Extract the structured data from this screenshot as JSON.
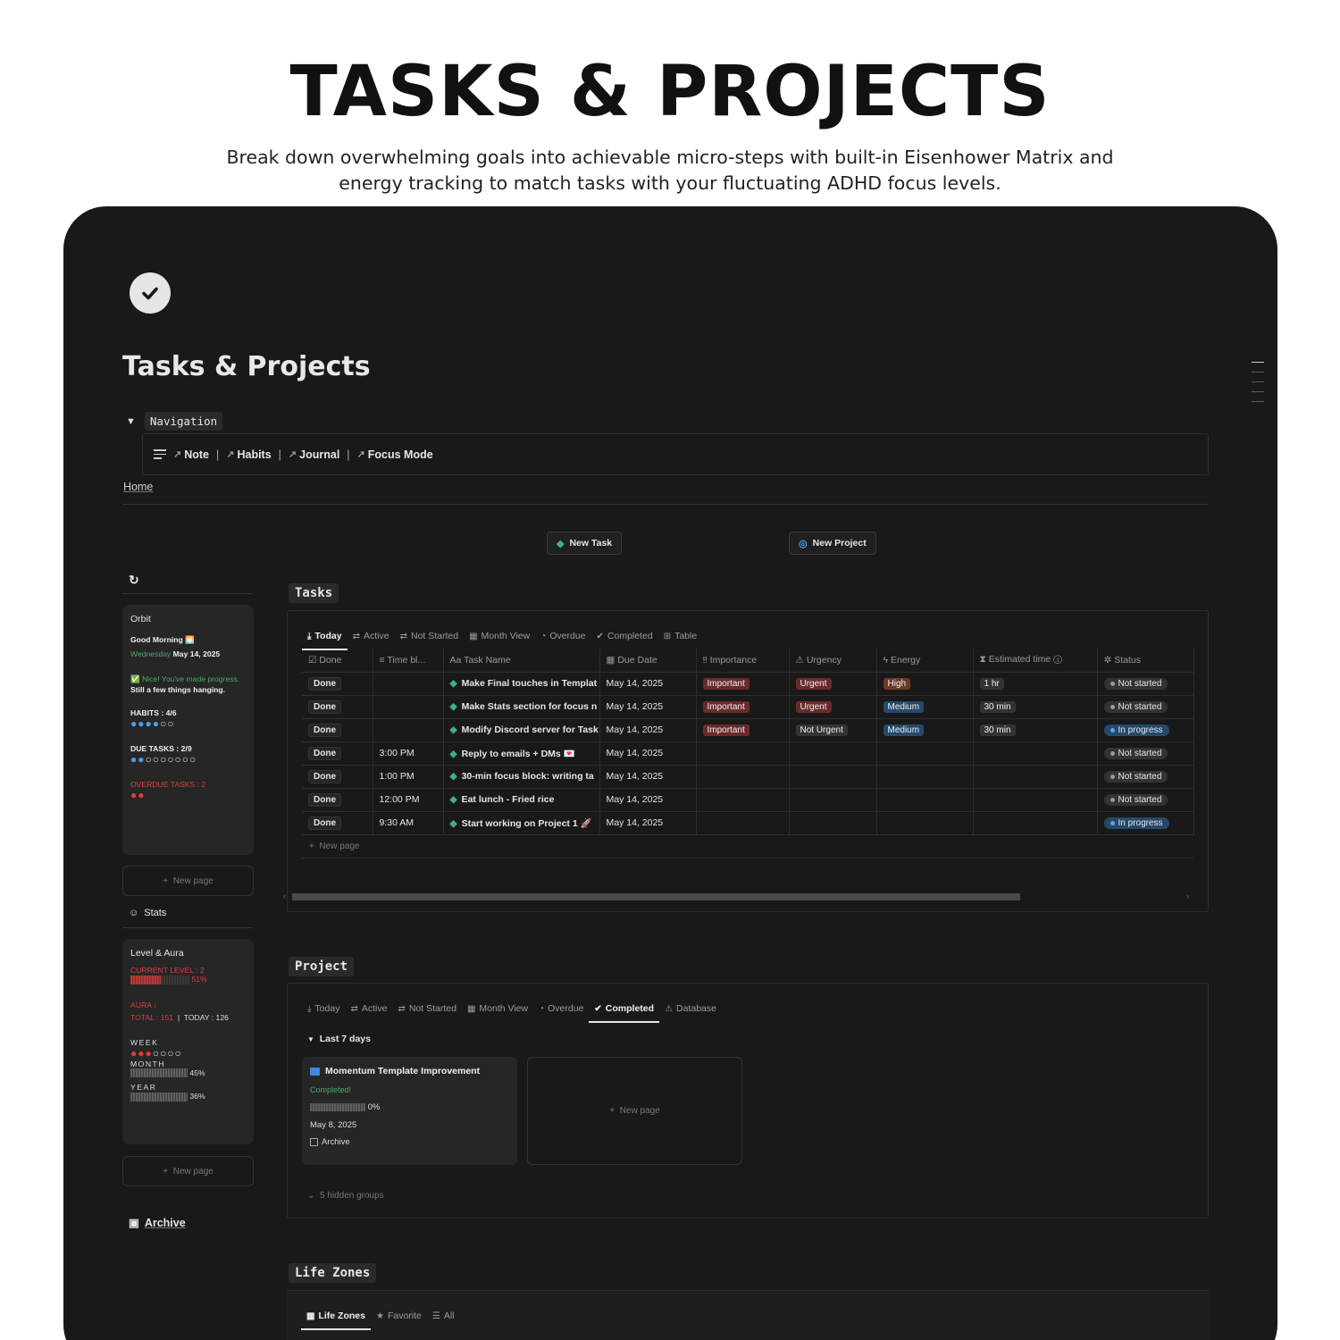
{
  "hero": {
    "title": "TASKS & PROJECTS",
    "subtitle": "Break down overwhelming goals into achievable micro-steps with built-in Eisenhower Matrix and energy tracking to match tasks with your fluctuating ADHD focus levels."
  },
  "page": {
    "icon": "check-circle-icon",
    "title": "Tasks & Projects",
    "nav_toggle": "Navigation",
    "nav_items": [
      {
        "label": "Note",
        "icon": "note-link-icon"
      },
      {
        "label": "Habits",
        "icon": "habits-link-icon"
      },
      {
        "label": "Journal",
        "icon": "journal-link-icon"
      },
      {
        "label": "Focus Mode",
        "icon": "focus-link-icon"
      }
    ],
    "nav_separator": "|",
    "breadcrumb_home": "Home",
    "new_task": "New Task",
    "new_project": "New Project"
  },
  "sidebar": {
    "orbit": {
      "title": "Orbit",
      "greeting": "Good Morning 🌅",
      "weekday": "Wednesday",
      "date": "May 14, 2025",
      "progress_msg": "✅ Nice! You've made progress.",
      "hanging_msg": "Still a few things hanging.",
      "habits_label": "HABITS : 4/6",
      "habits_done": 4,
      "habits_total": 6,
      "due_label": "DUE TASKS : 2/9",
      "due_done": 2,
      "due_total": 9,
      "overdue_label": "OVERDUE TASKS : 2",
      "overdue_count": 2
    },
    "new_page": "New page",
    "stats_label": "Stats",
    "level": {
      "title": "Level & Aura",
      "current_level": "CURRENT LEVEL :  2",
      "level_pct_label": "51%",
      "level_pct": 0.51,
      "aura": "AURA ↓",
      "total": "TOTAL : 151",
      "today": "TODAY : 126",
      "week_label": "WEEK",
      "week_done": 3,
      "week_total": 7,
      "month_label": "MONTH",
      "month_pct": "45%",
      "year_label": "YEAR",
      "year_pct": "36%"
    },
    "archive": "Archive"
  },
  "tasks": {
    "title": "Tasks",
    "tabs": [
      {
        "label": "Today",
        "icon": "download-icon",
        "active": true
      },
      {
        "label": "Active",
        "icon": "repeat-icon"
      },
      {
        "label": "Not Started",
        "icon": "repeat-icon"
      },
      {
        "label": "Month View",
        "icon": "calendar-icon"
      },
      {
        "label": "Overdue",
        "icon": "clock-icon"
      },
      {
        "label": "Completed",
        "icon": "check-circle-icon"
      },
      {
        "label": "Table",
        "icon": "table-icon"
      }
    ],
    "columns": [
      "Done",
      "Time bl...",
      "Task Name",
      "Due Date",
      "Importance",
      "Urgency",
      "Energy",
      "Estimated time",
      "Status"
    ],
    "rows": [
      {
        "done": "Done",
        "time": "",
        "name": "Make Final touches in Templat",
        "due": "May 14, 2025",
        "importance": "Important",
        "urgency": "Urgent",
        "energy": "High",
        "est": "1 hr",
        "status": "Not started"
      },
      {
        "done": "Done",
        "time": "",
        "name": "Make Stats section for focus n",
        "due": "May 14, 2025",
        "importance": "Important",
        "urgency": "Urgent",
        "energy": "Medium",
        "est": "30 min",
        "status": "Not started"
      },
      {
        "done": "Done",
        "time": "",
        "name": "Modify Discord server for Task",
        "due": "May 14, 2025",
        "importance": "Important",
        "urgency": "Not Urgent",
        "energy": "Medium",
        "est": "30 min",
        "status": "In progress"
      },
      {
        "done": "Done",
        "time": "3:00 PM",
        "name": "Reply to emails + DMs 💌",
        "due": "May 14, 2025",
        "importance": "",
        "urgency": "",
        "energy": "",
        "est": "",
        "status": "Not started"
      },
      {
        "done": "Done",
        "time": "1:00 PM",
        "name": "30-min focus block: writing ta",
        "due": "May 14, 2025",
        "importance": "",
        "urgency": "",
        "energy": "",
        "est": "",
        "status": "Not started"
      },
      {
        "done": "Done",
        "time": "12:00 PM",
        "name": "Eat lunch - Fried rice",
        "due": "May 14, 2025",
        "importance": "",
        "urgency": "",
        "energy": "",
        "est": "",
        "status": "Not started"
      },
      {
        "done": "Done",
        "time": "9:30 AM",
        "name": "Start working on Project 1 🚀",
        "due": "May 14, 2025",
        "importance": "",
        "urgency": "",
        "energy": "",
        "est": "",
        "status": "In progress"
      }
    ],
    "new_page": "New page"
  },
  "project": {
    "title": "Project",
    "tabs": [
      {
        "label": "Today",
        "icon": "download-icon"
      },
      {
        "label": "Active",
        "icon": "repeat-icon"
      },
      {
        "label": "Not Started",
        "icon": "repeat-icon"
      },
      {
        "label": "Month View",
        "icon": "calendar-icon"
      },
      {
        "label": "Overdue",
        "icon": "clock-icon"
      },
      {
        "label": "Completed",
        "icon": "check-circle-icon",
        "active": true
      },
      {
        "label": "Database",
        "icon": "warning-icon"
      }
    ],
    "group": "Last 7 days",
    "card": {
      "title": "Momentum Template Improvement",
      "status": "Completed!",
      "progress": "0%",
      "date": "May 8, 2025",
      "archive": "Archive"
    },
    "new_page": "New page",
    "hidden_groups": "5 hidden groups"
  },
  "life_zones": {
    "title": "Life Zones",
    "tabs": [
      {
        "label": "Life Zones",
        "icon": "grid-icon",
        "active": true
      },
      {
        "label": "Favorite",
        "icon": "star-icon"
      },
      {
        "label": "All",
        "icon": "list-icon"
      }
    ]
  },
  "colors": {
    "background": "#191919",
    "accent_green": "#3fb37f",
    "accent_red": "#e03e3e",
    "accent_blue": "#4a9ee6"
  }
}
